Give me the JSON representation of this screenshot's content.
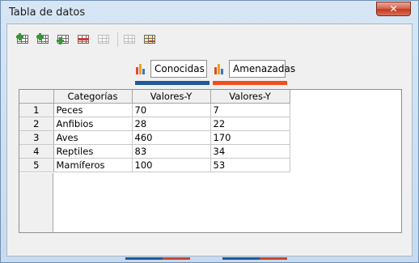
{
  "window": {
    "title": "Tabla de datos",
    "close_glyph": "✕"
  },
  "toolbar": {
    "buttons": [
      {
        "name": "insert-row-button",
        "icon": "insert-row-icon"
      },
      {
        "name": "insert-series-button",
        "icon": "insert-series-icon"
      },
      {
        "name": "insert-text-column-button",
        "icon": "insert-text-column-icon"
      },
      {
        "name": "delete-row-button",
        "icon": "delete-row-icon"
      },
      {
        "name": "delete-series-button",
        "icon": "delete-series-icon",
        "enabled": false
      },
      {
        "name": "move-series-button",
        "icon": "move-series-icon",
        "enabled": false
      },
      {
        "name": "move-row-button",
        "icon": "move-row-icon"
      }
    ]
  },
  "series": [
    {
      "label": "Conocidas",
      "color": "#1f5a9c"
    },
    {
      "label": "Amenazadas",
      "color": "#f04e1c"
    }
  ],
  "table": {
    "headers": [
      "Categorías",
      "Valores-Y",
      "Valores-Y"
    ],
    "rows": [
      {
        "num": "1",
        "cat": "Peces",
        "v1": "70",
        "v2": "7"
      },
      {
        "num": "2",
        "cat": "Anfibios",
        "v1": "28",
        "v2": "22"
      },
      {
        "num": "3",
        "cat": "Aves",
        "v1": "460",
        "v2": "170"
      },
      {
        "num": "4",
        "cat": "Reptiles",
        "v1": "83",
        "v2": "34"
      },
      {
        "num": "5",
        "cat": "Mamíferos",
        "v1": "100",
        "v2": "53"
      }
    ]
  },
  "colors": {
    "accent_blue": "#1f5a9c",
    "accent_orange": "#f04e1c"
  }
}
